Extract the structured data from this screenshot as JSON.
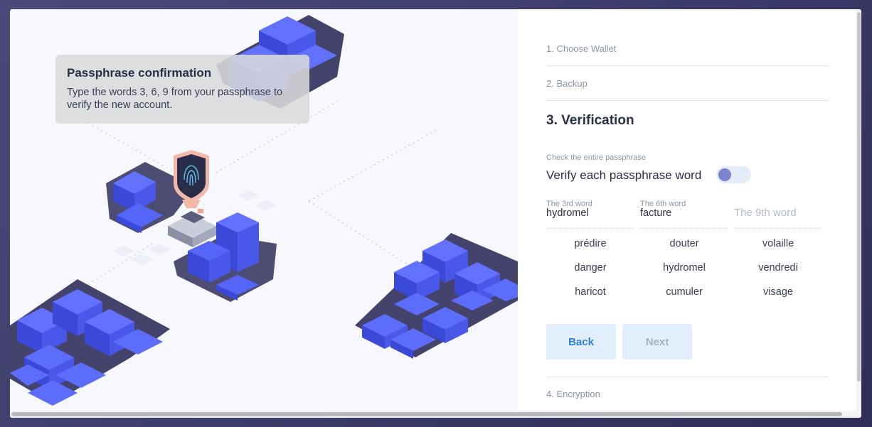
{
  "tooltip": {
    "title": "Passphrase confirmation",
    "body": "Type the words 3, 6, 9 from your passphrase to verify the new account."
  },
  "steps": {
    "step1": "1. Choose Wallet",
    "step2": "2. Backup",
    "step3": "3. Verification",
    "step4": "4. Encryption"
  },
  "verification": {
    "hint": "Check the entire passphrase",
    "toggle_label": "Verify each passphrase word",
    "toggle_on": false,
    "fields": [
      {
        "label": "The 3rd word",
        "value": "hydromel",
        "placeholder": ""
      },
      {
        "label": "The 6th word",
        "value": "facture",
        "placeholder": ""
      },
      {
        "label": "",
        "value": "",
        "placeholder": "The 9th word"
      }
    ],
    "word_options": [
      [
        "prédire",
        "douter",
        "volaille"
      ],
      [
        "danger",
        "hydromel",
        "vendredi"
      ],
      [
        "haricot",
        "cumuler",
        "visage"
      ]
    ]
  },
  "buttons": {
    "back": "Back",
    "next": "Next"
  },
  "colors": {
    "accent": "#2b7fe0",
    "button_bg": "#e2eefb",
    "illustration_blue": "#4a5cf0",
    "toggle_knob": "#7b85cf"
  },
  "icons": {
    "illustration": "isometric-blocks-with-fingerprint-shield"
  }
}
